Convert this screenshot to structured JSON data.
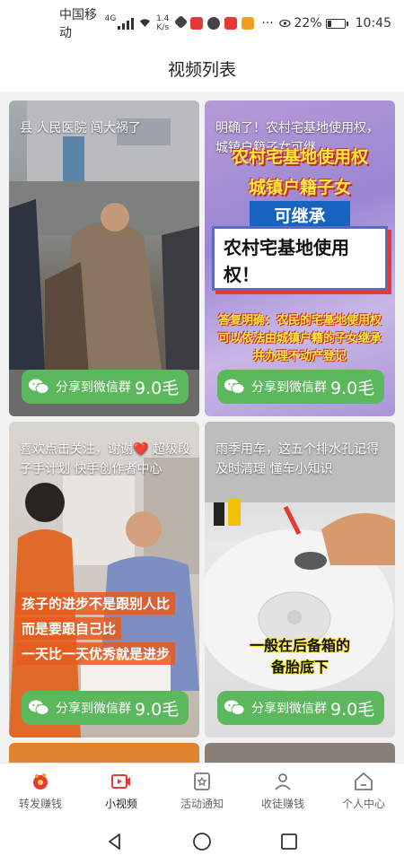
{
  "status_bar": {
    "carrier": "中国移动",
    "network": "4G",
    "speed_value": "1.4",
    "speed_unit": "K/s",
    "battery_percent": "22%",
    "battery_level": 0.22,
    "time": "10:45"
  },
  "header": {
    "title": "视频列表"
  },
  "videos": [
    {
      "title": "县 人民医院 闯大祸了",
      "share_label": "分享到微信群",
      "price": "9.0毛"
    },
    {
      "title": "明确了！农村宅基地使用权，城镇户籍子女可继",
      "overlay_lines": [
        "农村宅基地使用权",
        "城镇户籍子女",
        "可继承"
      ],
      "overlay_box": "农村宅基地使用权！",
      "overlay_bottom": "答复明确：农民的宅基地使用权可以依法由城镇户籍的子女继承并办理不动产登记",
      "share_label": "分享到微信群",
      "price": "9.0毛"
    },
    {
      "title": "喜欢点击关注，谢谢❤️ 超级段子手计划 快手创作者中心",
      "overlay_lines": [
        "孩子的进步不是跟别人比",
        "而是要跟自己比",
        "一天比一天优秀就是进步"
      ],
      "share_label": "分享到微信群",
      "price": "9.0毛"
    },
    {
      "title": "雨季用车，这五个排水孔记得及时清理 懂车小知识",
      "overlay_lines": [
        "一般在后备箱的",
        "备胎底下"
      ],
      "share_label": "分享到微信群",
      "price": "9.0毛"
    }
  ],
  "tabs": [
    {
      "label": "转发赚钱",
      "icon": "fire-coin-icon"
    },
    {
      "label": "小视频",
      "icon": "video-icon",
      "active": true
    },
    {
      "label": "活动通知",
      "icon": "notice-icon"
    },
    {
      "label": "收徒赚钱",
      "icon": "user-add-icon"
    },
    {
      "label": "个人中心",
      "icon": "home-icon"
    }
  ],
  "colors": {
    "share_green": "#5cb85c",
    "accent_red": "#e53935",
    "overlay_yellow": "#ffeb3b"
  }
}
